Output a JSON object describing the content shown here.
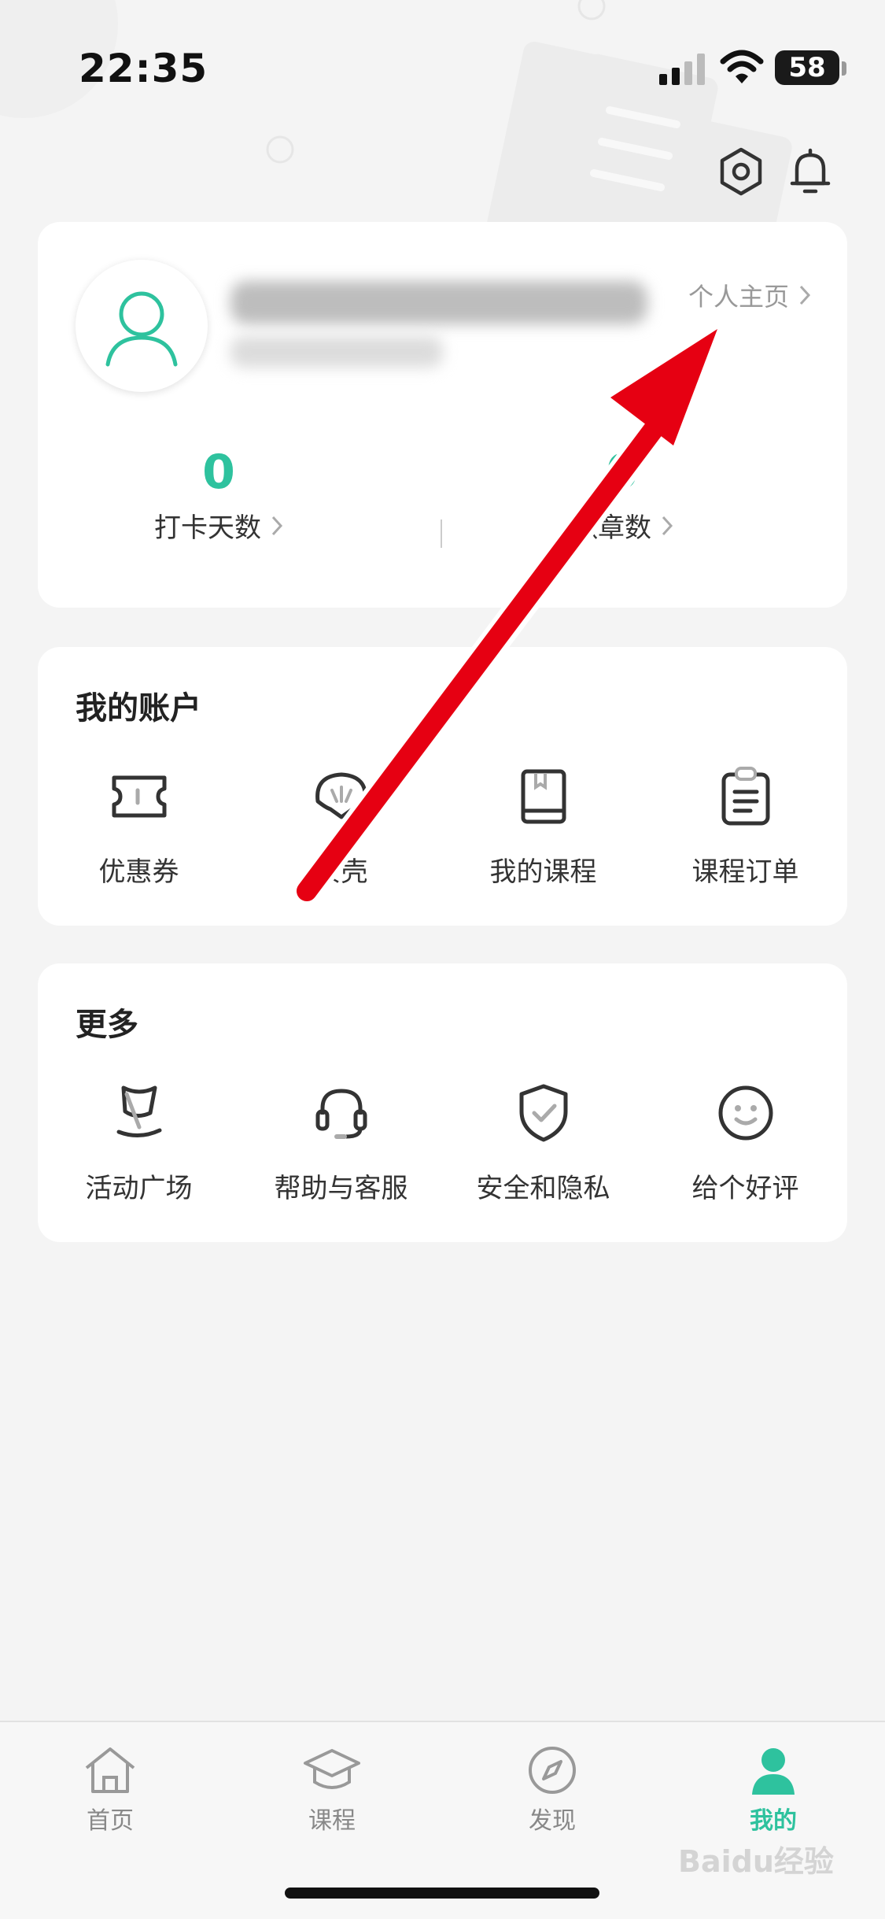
{
  "status_bar": {
    "time": "22:35",
    "battery": "58"
  },
  "profile": {
    "home_link": "个人主页",
    "stats": [
      {
        "value": "0",
        "label": "打卡天数"
      },
      {
        "value": "0",
        "label": "徽章数"
      }
    ]
  },
  "account": {
    "title": "我的账户",
    "items": [
      {
        "label": "优惠券",
        "icon": "coupon-icon"
      },
      {
        "label": "贝壳",
        "icon": "shell-icon"
      },
      {
        "label": "我的课程",
        "icon": "book-icon"
      },
      {
        "label": "课程订单",
        "icon": "clipboard-icon"
      }
    ]
  },
  "more": {
    "title": "更多",
    "items": [
      {
        "label": "活动广场",
        "icon": "flag-icon"
      },
      {
        "label": "帮助与客服",
        "icon": "headset-icon"
      },
      {
        "label": "安全和隐私",
        "icon": "shield-icon"
      },
      {
        "label": "给个好评",
        "icon": "smile-icon"
      }
    ]
  },
  "tabbar": {
    "items": [
      {
        "label": "首页",
        "icon": "home-icon"
      },
      {
        "label": "课程",
        "icon": "graduation-cap-icon"
      },
      {
        "label": "发现",
        "icon": "compass-icon"
      },
      {
        "label": "我的",
        "icon": "user-icon",
        "active": true
      }
    ]
  },
  "colors": {
    "accent": "#2ec29e",
    "arrow": "#e60012",
    "background": "#f4f4f4"
  },
  "watermark": "Baidu经验"
}
